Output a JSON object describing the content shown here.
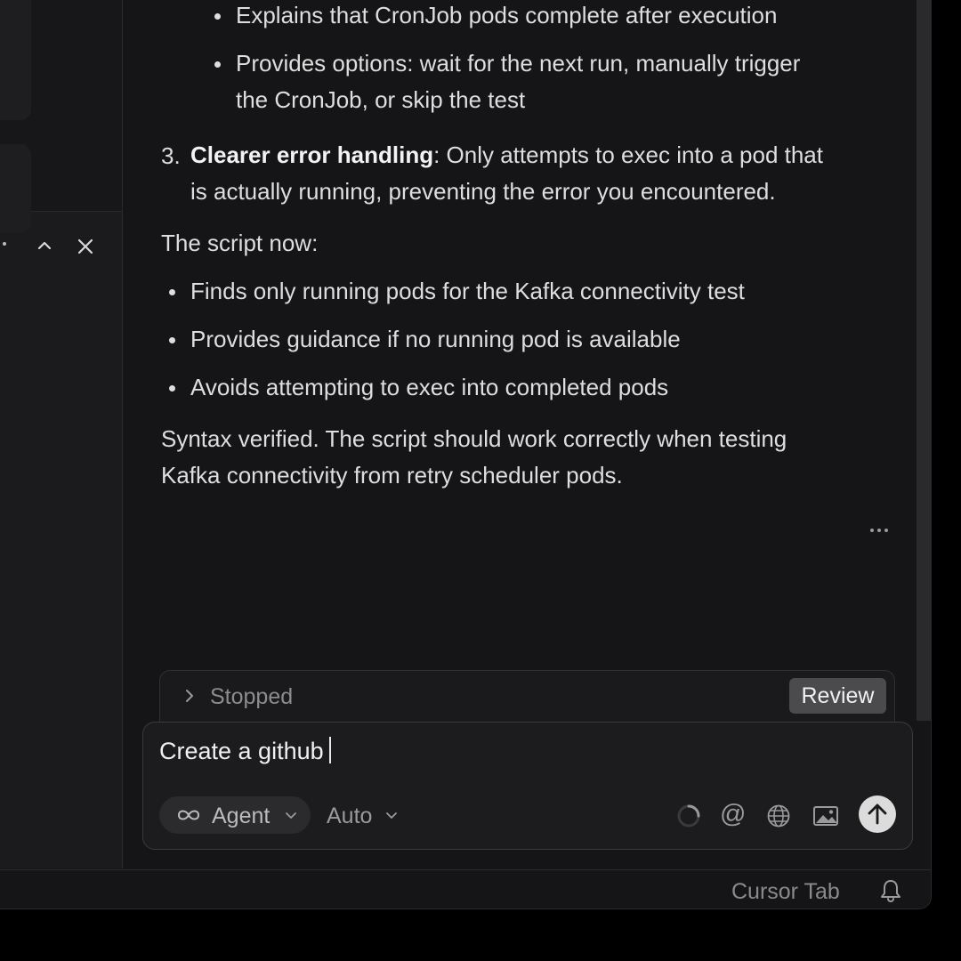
{
  "chat": {
    "sub_bullets": [
      "Explains that CronJob pods complete after execution",
      "Provides options: wait for the next run, manually trigger",
      "the CronJob, or skip the test"
    ],
    "numbered_item": {
      "number": "3.",
      "bold": "Clearer error handling",
      "rest_line1": ": Only attempts to exec into a pod that",
      "rest_line2": "is actually running, preventing the error you encountered."
    },
    "summary_intro": "The script now:",
    "summary_bullets": [
      "Finds only running pods for the Kafka connectivity test",
      "Provides guidance if no running pod is available",
      "Avoids attempting to exec into completed pods"
    ],
    "closing_line1": "Syntax verified. The script should work correctly when testing",
    "closing_line2": "Kafka connectivity from retry scheduler pods."
  },
  "stopped_bar": {
    "label": "Stopped",
    "review_label": "Review"
  },
  "composer": {
    "input_value": "Create a github",
    "mode_label": "Agent",
    "model_label": "Auto"
  },
  "status_bar": {
    "cursor_tab_label": "Cursor Tab"
  },
  "icons": {
    "chevron-up": "chevron-up-icon",
    "close": "close-icon",
    "more": "more-icon",
    "chevron-right": "chevron-right-icon",
    "infinity": "infinity-icon",
    "spinner": "spinner-icon",
    "at": "at-icon",
    "globe": "globe-icon",
    "image": "image-icon",
    "send": "arrow-up-icon",
    "bell": "bell-icon"
  }
}
